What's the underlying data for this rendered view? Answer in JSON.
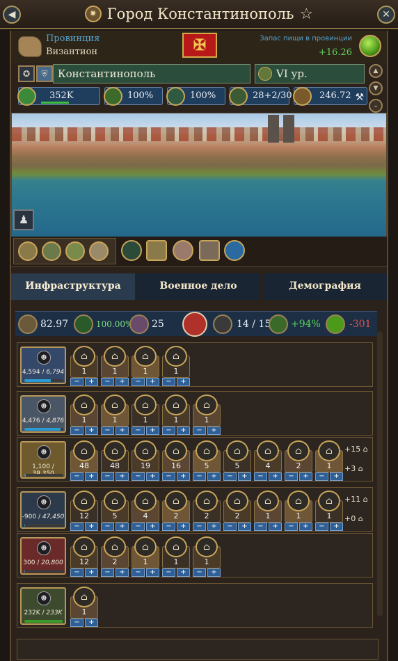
{
  "window": {
    "title": "Город Константинополь"
  },
  "province": {
    "label": "Провинция",
    "name": "Византион",
    "food_label": "Запас пищи в провинции",
    "food_value": "+16.26"
  },
  "city": {
    "name": "Константинополь",
    "level": "VI ур."
  },
  "stats": [
    {
      "icon": "population-icon",
      "value": "352K",
      "color": "#3a8a3a"
    },
    {
      "icon": "barrel-icon",
      "value": "100%",
      "color": "#3c6a2a"
    },
    {
      "icon": "key-icon",
      "value": "100%",
      "color": "#2f5a40"
    },
    {
      "icon": "scroll-icon",
      "value": "28+2/30",
      "color": "#3c5a34"
    },
    {
      "icon": "gold-icon",
      "value": "246.72",
      "color": "#7a5a2a"
    }
  ],
  "tabs": [
    {
      "label": "Инфраструктура",
      "active": true
    },
    {
      "label": "Военное дело",
      "active": false
    },
    {
      "label": "Демография",
      "active": false
    }
  ],
  "summary": {
    "gold": "82.97",
    "growth": "100.00%",
    "culture": "25",
    "people": "14 / 15",
    "food_growth": "+94%",
    "food": "-301"
  },
  "categories": [
    {
      "value": "4,594",
      "capacity": "6,794",
      "fill": 0.68,
      "box_color": "#34486a",
      "bar_color": "#2a9ad0",
      "buildings": [
        {
          "count": "1"
        },
        {
          "count": "1"
        },
        {
          "count": "1"
        },
        {
          "count": "1"
        }
      ]
    },
    {
      "value": "4,476",
      "capacity": "4,876",
      "fill": 0.92,
      "box_color": "#4a5566",
      "bar_color": "#2a9ad0",
      "buildings": [
        {
          "count": "1"
        },
        {
          "count": "1"
        },
        {
          "count": "1"
        },
        {
          "count": "1"
        },
        {
          "count": "1"
        }
      ]
    },
    {
      "value": "1,100",
      "capacity": "39,350",
      "fill": 0.03,
      "box_color": "#6e5a2c",
      "bar_color": "#2a9ad0",
      "buildings": [
        {
          "count": "48"
        },
        {
          "count": "48"
        },
        {
          "count": "19"
        },
        {
          "count": "16"
        },
        {
          "count": "5"
        },
        {
          "count": "5"
        },
        {
          "count": "4"
        },
        {
          "count": "2"
        },
        {
          "count": "1"
        }
      ],
      "side": [
        "+15",
        "+3"
      ]
    },
    {
      "value": "-900",
      "capacity": "47,450",
      "fill": 0.02,
      "box_color": "#2c3a4c",
      "bar_color": "#2a9ad0",
      "buildings": [
        {
          "count": "12"
        },
        {
          "count": "5"
        },
        {
          "count": "4"
        },
        {
          "count": "2"
        },
        {
          "count": "2"
        },
        {
          "count": "2"
        },
        {
          "count": "1"
        },
        {
          "count": "1"
        },
        {
          "count": "1"
        }
      ],
      "side": [
        "+11",
        "+0"
      ]
    },
    {
      "value": "300",
      "capacity": "20,800",
      "fill": 0.02,
      "box_color": "#6a2a2a",
      "bar_color": "#2a9ad0",
      "buildings": [
        {
          "count": "12"
        },
        {
          "count": "2"
        },
        {
          "count": "1"
        },
        {
          "count": "1"
        },
        {
          "count": "1"
        }
      ]
    },
    {
      "value": "232K",
      "capacity": "233K",
      "fill": 0.99,
      "box_color": "#3e4a2e",
      "bar_color": "#3a9a2a",
      "buildings": [
        {
          "count": "1"
        }
      ]
    }
  ]
}
